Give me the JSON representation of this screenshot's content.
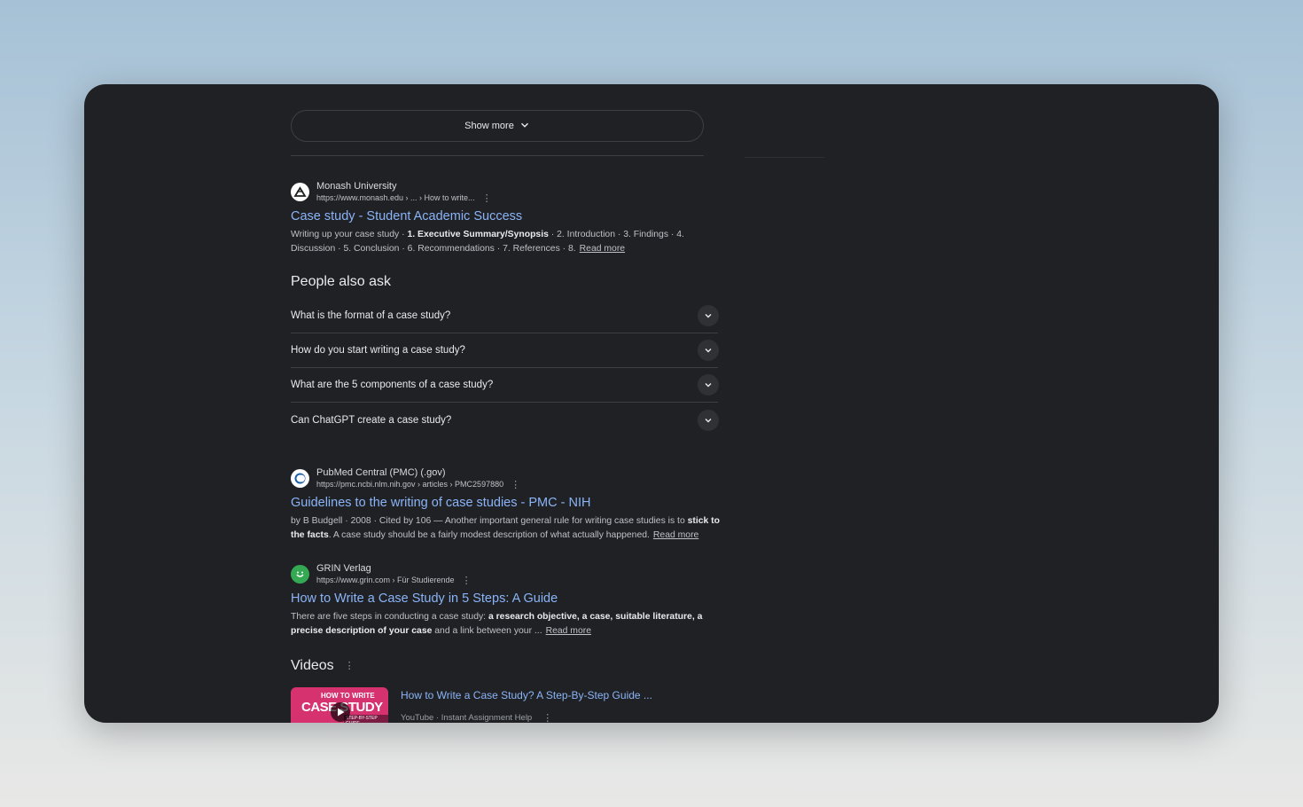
{
  "show_more": {
    "label": "Show more"
  },
  "results": [
    {
      "source_name": "Monash University",
      "source_url": "https://www.monash.edu › ... › How to write...",
      "title": "Case study - Student Academic Success",
      "snippet_parts": [
        "Writing up your case study · ",
        "1. Executive Summary/Synopsis",
        " · 2. Introduction · 3. Findings · 4. Discussion · 5. Conclusion · 6. Recommendations · 7. References · 8."
      ],
      "read_more": "Read more",
      "favicon_color": "#ffffff"
    },
    {
      "source_name": "PubMed Central (PMC) (.gov)",
      "source_url": "https://pmc.ncbi.nlm.nih.gov › articles › PMC2597880",
      "title": "Guidelines to the writing of case studies - PMC - NIH",
      "snippet_parts": [
        "by B Budgell · 2008 · Cited by 106 — Another important general rule for writing case studies is to ",
        "stick to the facts",
        ". A case study should be a fairly modest description of what actually happened."
      ],
      "read_more": "Read more",
      "favicon_color": "#ffffff"
    },
    {
      "source_name": "GRIN Verlag",
      "source_url": "https://www.grin.com › Für Studierende",
      "title": "How to Write a Case Study in 5 Steps: A Guide",
      "snippet_parts": [
        "There are five steps in conducting a case study: ",
        "a research objective, a case, suitable literature, a precise description of your case",
        " and a link between your ..."
      ],
      "read_more": "Read more",
      "favicon_color": "#34a853"
    }
  ],
  "people_also_ask": {
    "title": "People also ask",
    "questions": [
      "What is the format of a case study?",
      "How do you start writing a case study?",
      "What are the 5 components of a case study?",
      "Can ChatGPT create a case study?"
    ]
  },
  "videos": {
    "title": "Videos",
    "items": [
      {
        "title": "How to Write a Case Study? A Step-By-Step Guide ...",
        "meta": "YouTube · Instant Assignment Help",
        "thumb_line1": "HOW TO WRITE",
        "thumb_line2": "CASE STUDY",
        "thumb_line3": "STEP-BY-STEP GUIDE"
      }
    ]
  },
  "colors": {
    "background": "#202124",
    "link": "#8ab4f8",
    "text": "#e8eaed"
  }
}
